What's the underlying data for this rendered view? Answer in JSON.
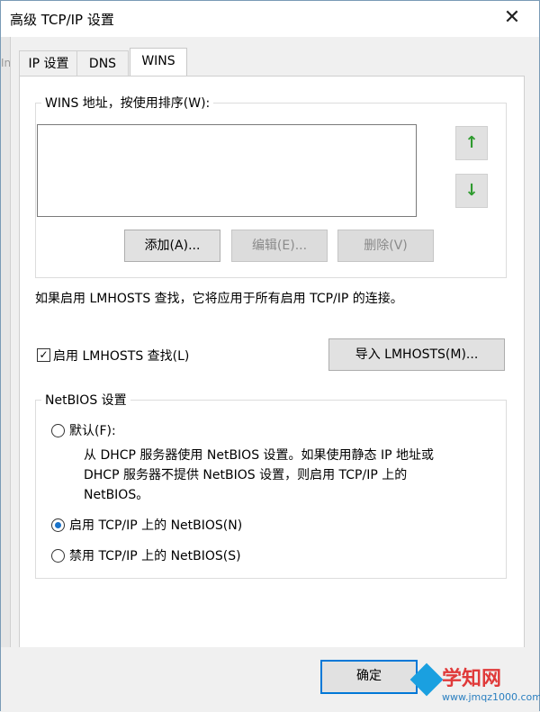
{
  "window": {
    "title": "高级 TCP/IP 设置",
    "close_glyph": "✕"
  },
  "background": {
    "glyph": "In"
  },
  "tabs": [
    {
      "label": "IP 设置"
    },
    {
      "label": "DNS"
    },
    {
      "label": "WINS",
      "active": true
    }
  ],
  "wins": {
    "group_label": "WINS 地址，按使用排序(W):",
    "up_glyph": "↑",
    "down_glyph": "↓",
    "add_label": "添加(A)...",
    "edit_label": "编辑(E)...",
    "delete_label": "删除(V)"
  },
  "lmhosts": {
    "info": "如果启用 LMHOSTS 查找，它将应用于所有启用 TCP/IP 的连接。",
    "checkbox_label": "启用 LMHOSTS 查找(L)",
    "checked": true,
    "check_glyph": "✓",
    "import_label": "导入 LMHOSTS(M)..."
  },
  "netbios": {
    "group_label": "NetBIOS 设置",
    "options": [
      {
        "label": "默认(F):",
        "checked": false
      },
      {
        "label": "启用 TCP/IP 上的 NetBIOS(N)",
        "checked": true
      },
      {
        "label": "禁用 TCP/IP 上的 NetBIOS(S)",
        "checked": false
      }
    ],
    "default_desc_line1": "从 DHCP 服务器使用 NetBIOS 设置。如果使用静态 IP 地址或",
    "default_desc_line2": "DHCP 服务器不提供 NetBIOS 设置，则启用 TCP/IP 上的",
    "default_desc_line3": "NetBIOS。"
  },
  "footer": {
    "ok_label": "确定"
  },
  "watermark": {
    "text": "学知网",
    "sub": "www.jmqz1000.com"
  },
  "colors": {
    "accent": "#0078d7",
    "arrow_green": "#2f9b2f",
    "radio_fill": "#1a73c9"
  }
}
